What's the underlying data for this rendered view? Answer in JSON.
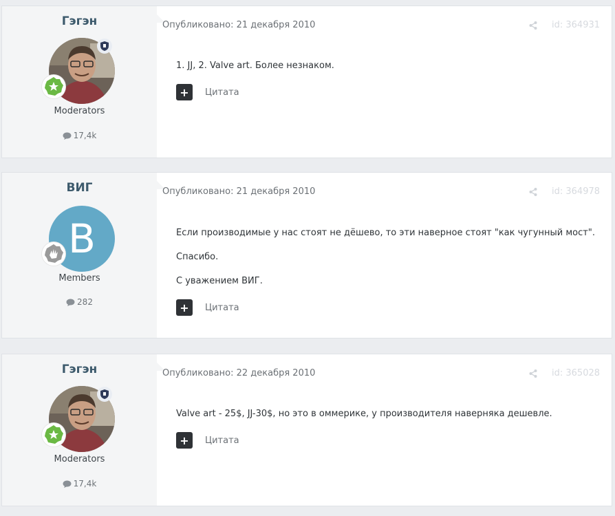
{
  "posts": [
    {
      "author": "Гэгэн",
      "group": "Moderators",
      "post_count": "17,4k",
      "date": "Опубликовано: 21 декабря 2010",
      "id_label": "id: 364931",
      "paragraphs": [
        "1. JJ, 2. Valve art. Более незнаком."
      ],
      "quote_label": "Цитата"
    },
    {
      "author": "ВИГ",
      "group": "Members",
      "post_count": "282",
      "avatar_letter": "B",
      "date": "Опубликовано: 21 декабря 2010",
      "id_label": "id: 364978",
      "paragraphs": [
        "Если производимые у нас стоят не дёшево, то эти наверное стоят \"как чугунный мост\".",
        "Спасибо.",
        "С уважением ВИГ."
      ],
      "quote_label": "Цитата"
    },
    {
      "author": "Гэгэн",
      "group": "Moderators",
      "post_count": "17,4k",
      "date": "Опубликовано: 22 декабря 2010",
      "id_label": "id: 365028",
      "paragraphs": [
        "Valve art - 25$, JJ-30$, но это в оммерике, у производителя наверняка дешевле."
      ],
      "quote_label": "Цитата"
    }
  ],
  "icons": {
    "comment": "comment-icon",
    "share": "share-icon",
    "moderator": "shield-icon",
    "rank_star": "star-rank-icon",
    "rank_hand": "hand-rank-icon",
    "quote_add": "plus-icon"
  },
  "colors": {
    "name": "#3d5a6c",
    "letter_avatar_bg": "#63a9c7",
    "rank_green": "#6bb944",
    "rank_grey": "#9a9a9a"
  }
}
